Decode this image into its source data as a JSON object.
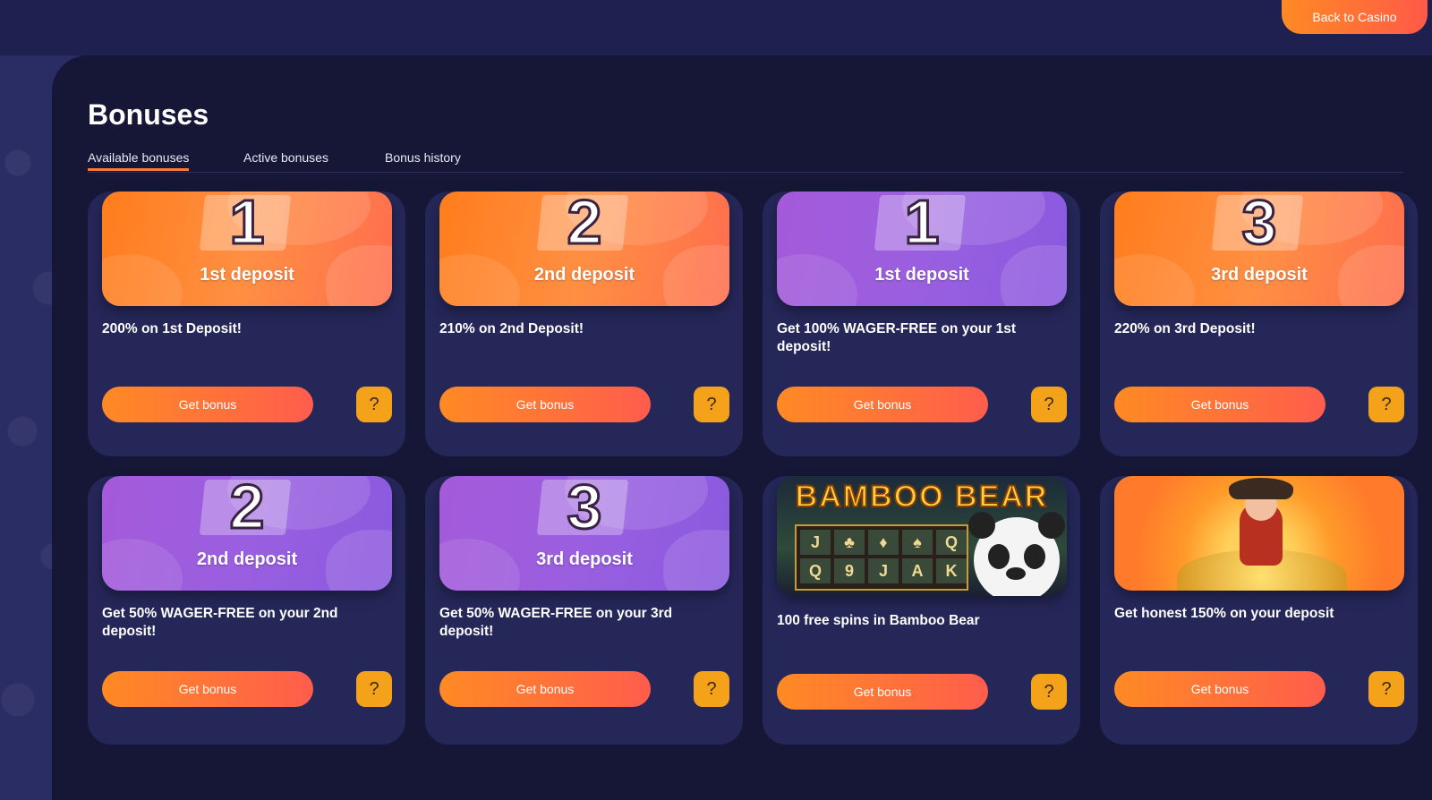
{
  "header": {
    "back_label": "Back to Casino"
  },
  "page": {
    "title": "Bonuses"
  },
  "tabs": [
    {
      "label": "Available bonuses",
      "active": true
    },
    {
      "label": "Active bonuses",
      "active": false
    },
    {
      "label": "Bonus history",
      "active": false
    }
  ],
  "cards": [
    {
      "theme": "orange",
      "number": "1",
      "banner_label": "1st deposit",
      "title": "200% on 1st Deposit!",
      "button": "Get bonus",
      "help": "?"
    },
    {
      "theme": "orange",
      "number": "2",
      "banner_label": "2nd deposit",
      "title": "210% on 2nd Deposit!",
      "button": "Get bonus",
      "help": "?"
    },
    {
      "theme": "purple",
      "number": "1",
      "banner_label": "1st deposit",
      "title": "Get 100% WAGER-FREE on your 1st deposit!",
      "button": "Get bonus",
      "help": "?"
    },
    {
      "theme": "orange",
      "number": "3",
      "banner_label": "3rd deposit",
      "title": "220% on 3rd Deposit!",
      "button": "Get bonus",
      "help": "?"
    },
    {
      "theme": "purple",
      "number": "2",
      "banner_label": "2nd deposit",
      "title": "Get 50% WAGER-FREE on your 2nd deposit!",
      "button": "Get bonus",
      "help": "?"
    },
    {
      "theme": "purple",
      "number": "3",
      "banner_label": "3rd deposit",
      "title": "Get 50% WAGER-FREE on your 3rd deposit!",
      "button": "Get bonus",
      "help": "?"
    },
    {
      "theme": "game",
      "game_title": "BAMBOO BEAR",
      "title": "100 free spins in Bamboo Bear",
      "button": "Get bonus",
      "help": "?"
    },
    {
      "theme": "pirate",
      "title": "Get honest 150% on your deposit",
      "button": "Get bonus",
      "help": "?"
    }
  ],
  "colors": {
    "accent": "#ff7a30",
    "help_button": "#f5a21b",
    "panel": "#161736",
    "card": "#252759"
  }
}
